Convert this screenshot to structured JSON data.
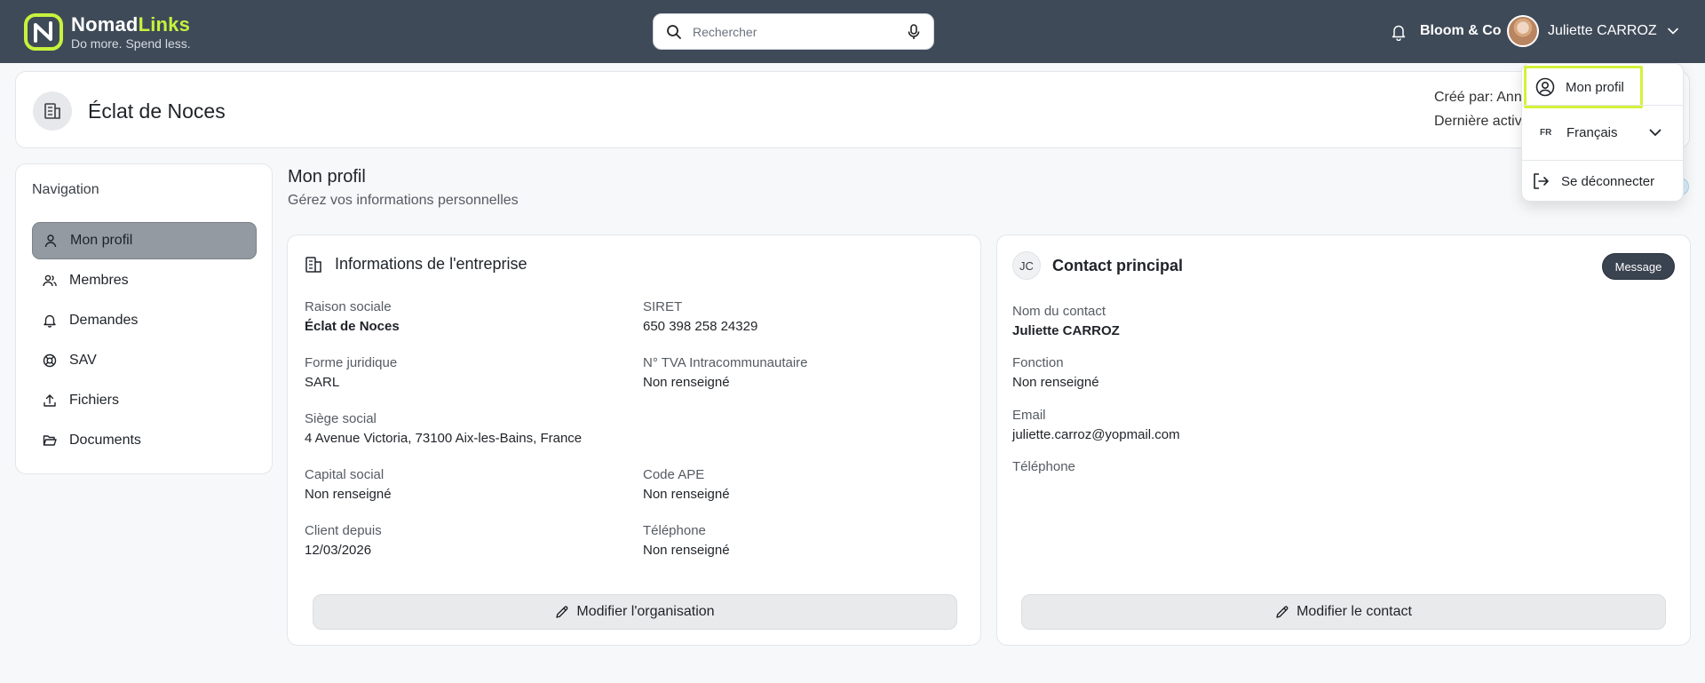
{
  "brand": {
    "name_part1": "Nomad",
    "name_part2": "Links",
    "tagline": "Do more. Spend less.",
    "accent_color": "#c8f23c",
    "topbar_color": "#3f4a58"
  },
  "search": {
    "placeholder": "Rechercher",
    "value": ""
  },
  "topbar": {
    "company": "Bloom & Co",
    "user_name": "Juliette CARROZ"
  },
  "header": {
    "org_name": "Éclat de Noces",
    "created_by": "Créé par: Ann",
    "last_activity": "Dernière activ"
  },
  "sidebar": {
    "title": "Navigation",
    "items": [
      {
        "label": "Mon profil",
        "icon": "user-icon",
        "active": true
      },
      {
        "label": "Membres",
        "icon": "users-icon",
        "active": false
      },
      {
        "label": "Demandes",
        "icon": "bell-icon",
        "active": false
      },
      {
        "label": "SAV",
        "icon": "lifebuoy-icon",
        "active": false
      },
      {
        "label": "Fichiers",
        "icon": "upload-icon",
        "active": false
      },
      {
        "label": "Documents",
        "icon": "folder-open-icon",
        "active": false
      }
    ]
  },
  "main": {
    "title": "Mon profil",
    "subtitle": "Gérez vos informations personnelles"
  },
  "company_card": {
    "title": "Informations de l'entreprise",
    "fields": {
      "raison_sociale": {
        "label": "Raison sociale",
        "value": "Éclat de Noces"
      },
      "siret": {
        "label": "SIRET",
        "value": "650 398 258 24329"
      },
      "forme": {
        "label": "Forme juridique",
        "value": "SARL"
      },
      "tva": {
        "label": "N° TVA Intracommunautaire",
        "value": "Non renseigné"
      },
      "siege": {
        "label": "Siège social",
        "value": "4 Avenue Victoria, 73100 Aix-les-Bains, France"
      },
      "capital": {
        "label": "Capital social",
        "value": "Non renseigné"
      },
      "ape": {
        "label": "Code APE",
        "value": "Non renseigné"
      },
      "client": {
        "label": "Client depuis",
        "value": "12/03/2026"
      },
      "telephone": {
        "label": "Téléphone",
        "value": "Non renseigné"
      }
    },
    "edit_label": "Modifier l'organisation"
  },
  "contact_card": {
    "initials": "JC",
    "title": "Contact principal",
    "message_label": "Message",
    "fields": {
      "nom": {
        "label": "Nom du contact",
        "value": "Juliette CARROZ"
      },
      "fonction": {
        "label": "Fonction",
        "value": "Non renseigné"
      },
      "email": {
        "label": "Email",
        "value": "juliette.carroz@yopmail.com"
      },
      "telephone": {
        "label": "Téléphone"
      }
    },
    "edit_label": "Modifier le contact"
  },
  "user_menu": {
    "profile_label": "Mon profil",
    "lang_code": "FR",
    "lang_label": "Français",
    "logout_label": "Se déconnecter",
    "highlight_color": "#d4f23a"
  }
}
